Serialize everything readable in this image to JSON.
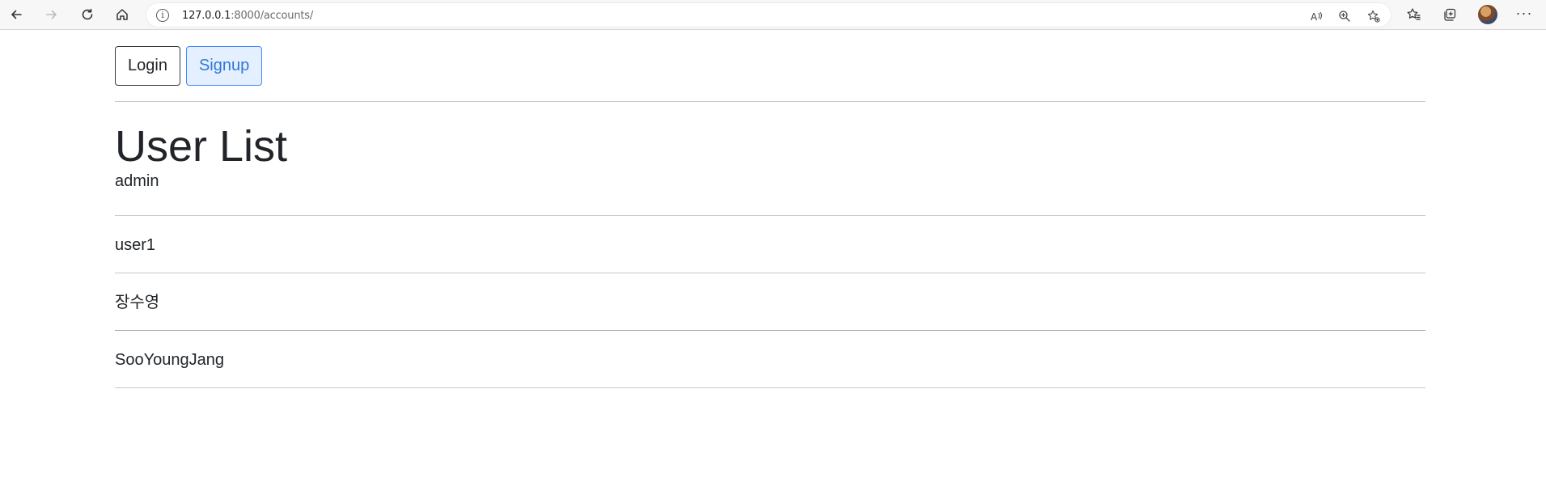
{
  "browser": {
    "url_host": "127.0.0.1",
    "url_path": ":8000/accounts/",
    "icons": {
      "back": "back-arrow-icon",
      "forward": "forward-arrow-icon",
      "refresh": "refresh-icon",
      "home": "home-icon",
      "info": "info-icon",
      "read_aloud": "read-aloud-icon",
      "zoom": "zoom-icon",
      "favorite_add": "favorite-add-icon",
      "favorites": "favorites-icon",
      "collections": "collections-icon",
      "profile": "avatar",
      "more": "more-icon"
    }
  },
  "nav": {
    "login_label": "Login",
    "signup_label": "Signup"
  },
  "page": {
    "title": "User List"
  },
  "users": [
    "admin",
    "user1",
    "장수영",
    "SooYoungJang"
  ],
  "colors": {
    "signup_accent": "#2f78d8",
    "signup_bg": "#e4efff",
    "divider": "#c9c9c9"
  }
}
